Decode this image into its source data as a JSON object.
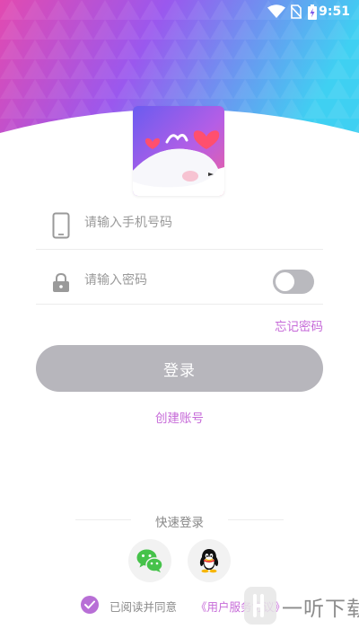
{
  "status_bar": {
    "time": "9:51",
    "icons": [
      "wifi-icon",
      "no-sim-icon",
      "battery-charging-icon"
    ]
  },
  "logo": {
    "name": "whale-hearts-logo"
  },
  "form": {
    "phone_placeholder": "请输入手机号码",
    "phone_icon": "phone-icon",
    "password_placeholder": "请输入密码",
    "password_icon": "lock-icon",
    "show_password_on": false,
    "forgot_label": "忘记密码",
    "login_label": "登录",
    "create_label": "创建账号"
  },
  "quick_login": {
    "title": "快速登录",
    "options": [
      "wechat-icon",
      "qq-icon"
    ]
  },
  "agreement": {
    "checked": true,
    "text": "已阅读并同意",
    "link": "《用户服务协议》"
  },
  "watermark": {
    "text": "一听下载"
  },
  "colors": {
    "accent": "#c66ad8",
    "button_disabled": "#b7b6bc",
    "gradient": [
      "#e05ab8",
      "#8b5cf0",
      "#3cc8f0"
    ]
  }
}
